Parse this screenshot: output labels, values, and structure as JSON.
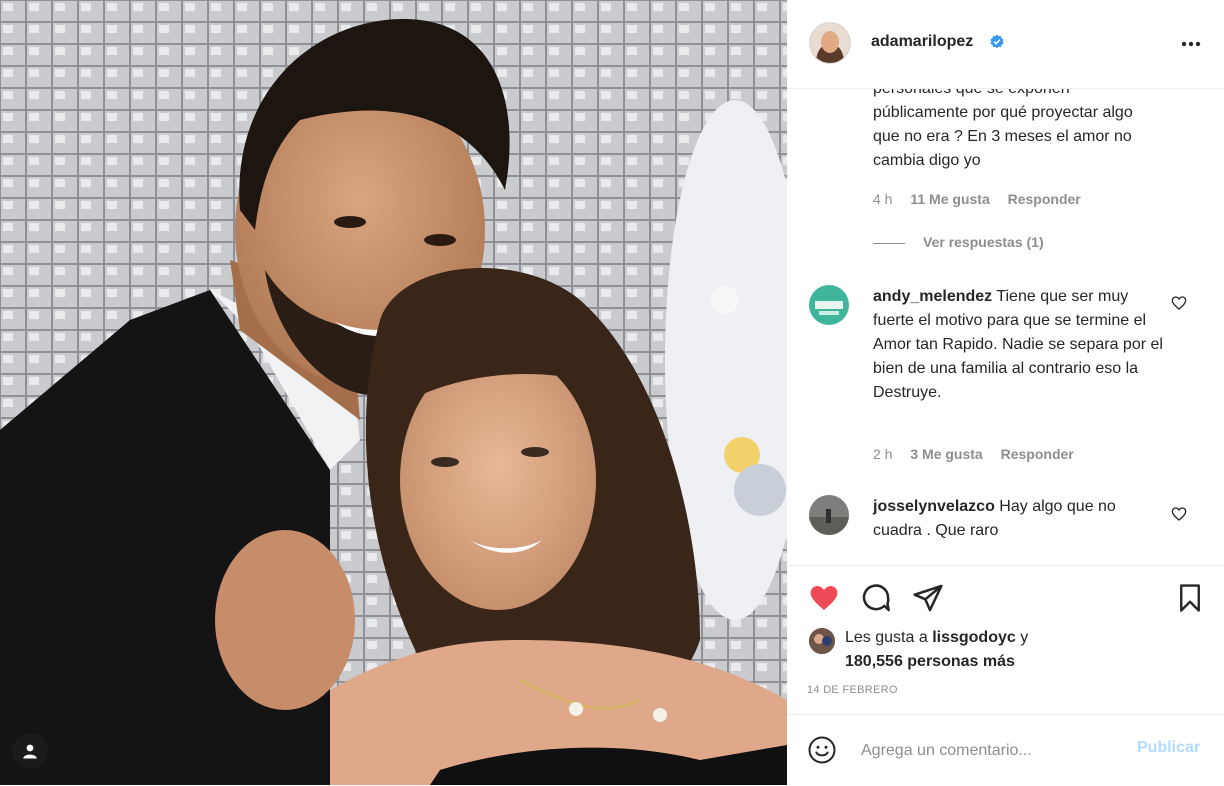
{
  "post": {
    "username": "adamarilopez",
    "verified": true,
    "comments": [
      {
        "username": "",
        "text": "personales que se exponen públicamente por qué proyectar algo que no era ? En 3 meses el amor no cambia digo yo",
        "time": "4 h",
        "likes": "11 Me gusta",
        "reply": "Responder",
        "view_replies": "Ver respuestas (1)"
      },
      {
        "username": "andy_melendez",
        "text": "Tiene que ser muy fuerte el motivo para que se termine el Amor tan Rapido. Nadie se separa por el bien de una familia al contrario eso la Destruye.",
        "time": "2 h",
        "likes": "3 Me gusta",
        "reply": "Responder"
      },
      {
        "username": "josselynvelazco",
        "text": "Hay algo que no cuadra . Que raro"
      }
    ],
    "likes_prefix": "Les gusta a",
    "likes_user": "lissgodoyc",
    "likes_connector": "y",
    "likes_count": "180,556 personas más",
    "date": "14 DE FEBRERO",
    "comment_placeholder": "Agrega un comentario...",
    "publish_label": "Publicar"
  },
  "colors": {
    "like_active": "#ed4956",
    "publish_disabled": "#b3dbff",
    "verified_blue": "#3897f0",
    "secondary_text": "#8e8e8e"
  },
  "icons": {
    "more": "more-horizontal-icon",
    "like": "heart-filled-icon",
    "comment": "comment-bubble-icon",
    "share": "paper-plane-icon",
    "save": "bookmark-icon",
    "emoji": "smiley-icon",
    "user_tag": "person-icon"
  }
}
